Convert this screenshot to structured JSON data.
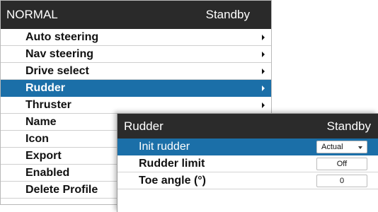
{
  "main_menu": {
    "title": "NORMAL",
    "status": "Standby",
    "items": [
      {
        "label": "Auto steering",
        "has_submenu": true
      },
      {
        "label": "Nav steering",
        "has_submenu": true
      },
      {
        "label": "Drive select",
        "has_submenu": true
      },
      {
        "label": "Rudder",
        "has_submenu": true,
        "selected": true
      },
      {
        "label": "Thruster",
        "has_submenu": true
      },
      {
        "label": "Name",
        "has_submenu": false
      },
      {
        "label": "Icon",
        "has_submenu": false
      },
      {
        "label": "Export",
        "has_submenu": false
      },
      {
        "label": "Enabled",
        "has_submenu": false
      },
      {
        "label": "Delete Profile",
        "has_submenu": false
      }
    ]
  },
  "rudder_dialog": {
    "title": "Rudder",
    "status": "Standby",
    "rows": [
      {
        "label": "Init rudder",
        "value": "Actual",
        "control": "dropdown",
        "selected": true
      },
      {
        "label": "Rudder limit",
        "value": "Off",
        "control": "field"
      },
      {
        "label": "Toe angle (°)",
        "value": "0",
        "control": "field"
      }
    ]
  },
  "colors": {
    "header_bg": "#2a2a2a",
    "selection_bg": "#1b6fa8",
    "panel_bg": "#ffffff"
  }
}
